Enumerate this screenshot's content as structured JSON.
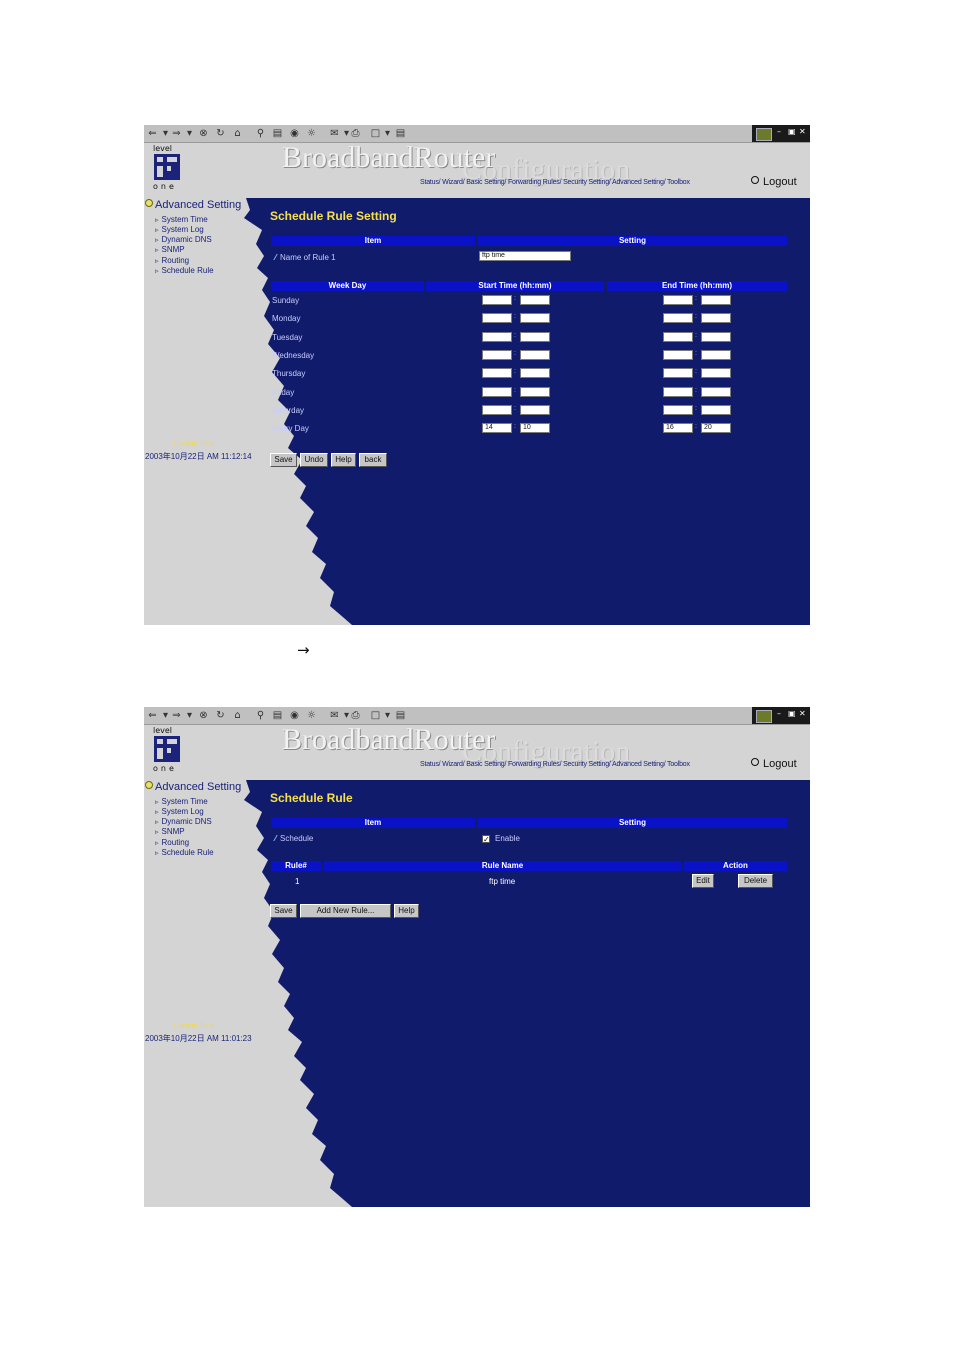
{
  "brand": {
    "logo_top": "level",
    "logo_bottom": "one",
    "title": "BroadbandRouter",
    "subtitle": "Configuration"
  },
  "nav_links": "Status/ Wizard/ Basic Setting/ Forwarding Rules/ Security Setting/ Advanced Setting/ Toolbox",
  "logout_label": "Logout",
  "menu": {
    "heading": "Advanced Setting",
    "items": [
      "System Time",
      "System Log",
      "Dynamic DNS",
      "SNMP",
      "Routing",
      "Schedule Rule"
    ]
  },
  "current_time_label": "Current Time",
  "arrow_glyph": "→",
  "screen1": {
    "current_time": "2003年10月22日 AM 11:12:14",
    "title": "Schedule Rule Setting",
    "header_item": "Item",
    "header_setting": "Setting",
    "name_label": "Name of Rule 1",
    "name_value": "ftp time",
    "col_weekday": "Week Day",
    "col_start": "Start Time (hh:mm)",
    "col_end": "End Time (hh:mm)",
    "days": [
      {
        "label": "Sunday",
        "sh": "",
        "sm": "",
        "eh": "",
        "em": ""
      },
      {
        "label": "Monday",
        "sh": "",
        "sm": "",
        "eh": "",
        "em": ""
      },
      {
        "label": "Tuesday",
        "sh": "",
        "sm": "",
        "eh": "",
        "em": ""
      },
      {
        "label": "Wednesday",
        "sh": "",
        "sm": "",
        "eh": "",
        "em": ""
      },
      {
        "label": "Thursday",
        "sh": "",
        "sm": "",
        "eh": "",
        "em": ""
      },
      {
        "label": "Friday",
        "sh": "",
        "sm": "",
        "eh": "",
        "em": ""
      },
      {
        "label": "Saturday",
        "sh": "",
        "sm": "",
        "eh": "",
        "em": ""
      },
      {
        "label": "Every Day",
        "sh": "14",
        "sm": "10",
        "eh": "16",
        "em": "20"
      }
    ],
    "buttons": {
      "save": "Save",
      "undo": "Undo",
      "help": "Help",
      "back": "back"
    }
  },
  "screen2": {
    "current_time": "2003年10月22日 AM 11:01:23",
    "title": "Schedule Rule",
    "header_item": "Item",
    "header_setting": "Setting",
    "schedule_label": "Schedule",
    "enable_label": "Enable",
    "enable_checked": true,
    "col_rule": "Rule#",
    "col_name": "Rule Name",
    "col_action": "Action",
    "rules": [
      {
        "num": "1",
        "name": "ftp time",
        "edit": "Edit",
        "delete": "Delete"
      }
    ],
    "buttons": {
      "save": "Save",
      "add": "Add New Rule...",
      "help": "Help"
    }
  },
  "colors": {
    "panel": "#101c6b",
    "header_bar": "#0a12c8",
    "title": "#f6e04a",
    "background": "#d4d4d4"
  }
}
